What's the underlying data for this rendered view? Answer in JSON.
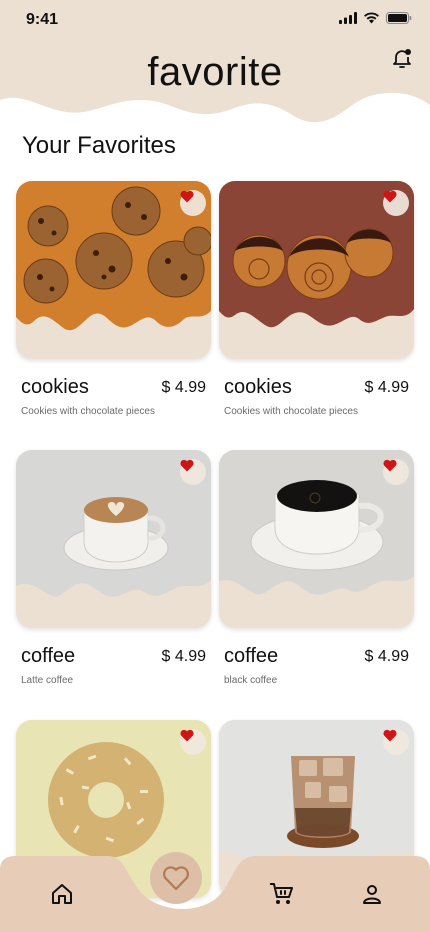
{
  "status": {
    "time": "9:41"
  },
  "header": {
    "title": "favorite"
  },
  "section": {
    "title": "Your Favorites"
  },
  "items": [
    {
      "name": "cookies",
      "price": "$ 4.99",
      "desc": "Cookies with chocolate pieces",
      "image": "cookies"
    },
    {
      "name": "cookies",
      "price": "$ 4.99",
      "desc": "Cookies with chocolate pieces",
      "image": "chocolate-rolls"
    },
    {
      "name": "coffee",
      "price": "$ 4.99",
      "desc": "Latte coffee",
      "image": "latte"
    },
    {
      "name": "coffee",
      "price": "$ 4.99",
      "desc": "black coffee",
      "image": "black-coffee"
    },
    {
      "name": "",
      "price": "",
      "desc": "",
      "image": "donut"
    },
    {
      "name": "",
      "price": "",
      "desc": "",
      "image": "iced-coffee"
    }
  ],
  "nav": {
    "items": [
      "home-icon",
      "heart-icon",
      "cart-icon",
      "profile-icon"
    ],
    "active": "heart-icon"
  },
  "colors": {
    "cream": "#ece0d2",
    "nav": "#e7cdb7",
    "heart": "#d11515"
  }
}
